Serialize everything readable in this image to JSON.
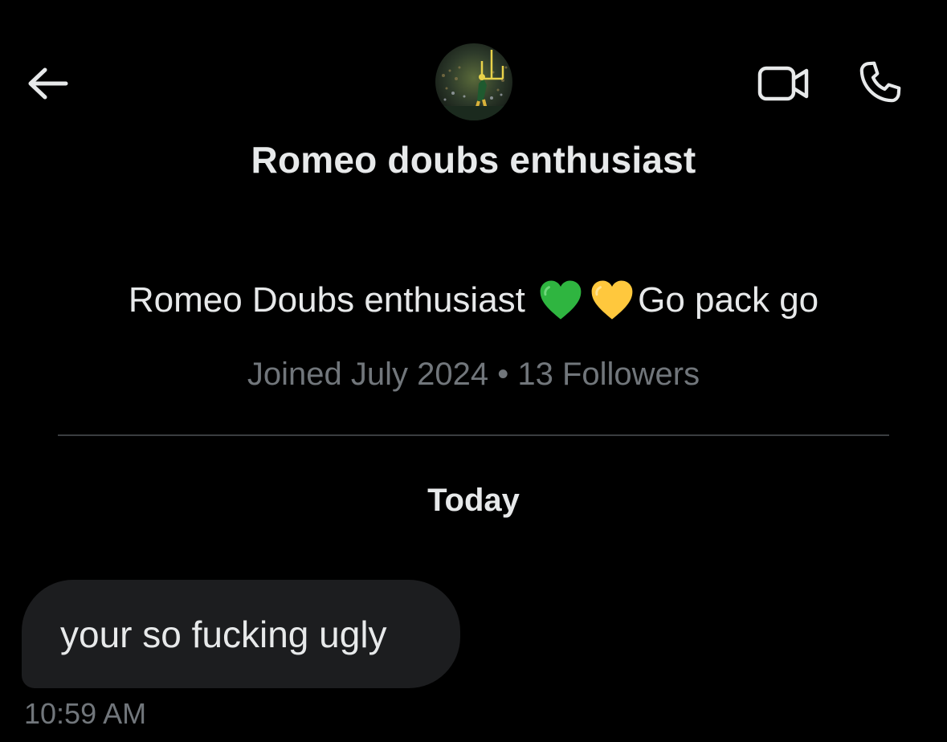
{
  "header": {
    "back_icon": "arrow-left-icon",
    "video_icon": "video-camera-icon",
    "call_icon": "phone-icon",
    "display_name": "Romeo doubs enthusiast"
  },
  "profile": {
    "bio_before": "Romeo Doubs enthusiast ",
    "bio_after": "Go pack go",
    "heart_colors": [
      "#2fb540",
      "#ffc83d"
    ],
    "meta": "Joined July 2024 • 13 Followers"
  },
  "conversation": {
    "date_separator": "Today",
    "messages": [
      {
        "text": "your so fucking ugly",
        "time": "10:59 AM",
        "direction": "incoming"
      }
    ]
  },
  "colors": {
    "background": "#000000",
    "text_primary": "#e7e9ea",
    "text_secondary": "#71767b",
    "bubble_incoming": "#1c1d1f",
    "divider": "#3a3d40"
  }
}
